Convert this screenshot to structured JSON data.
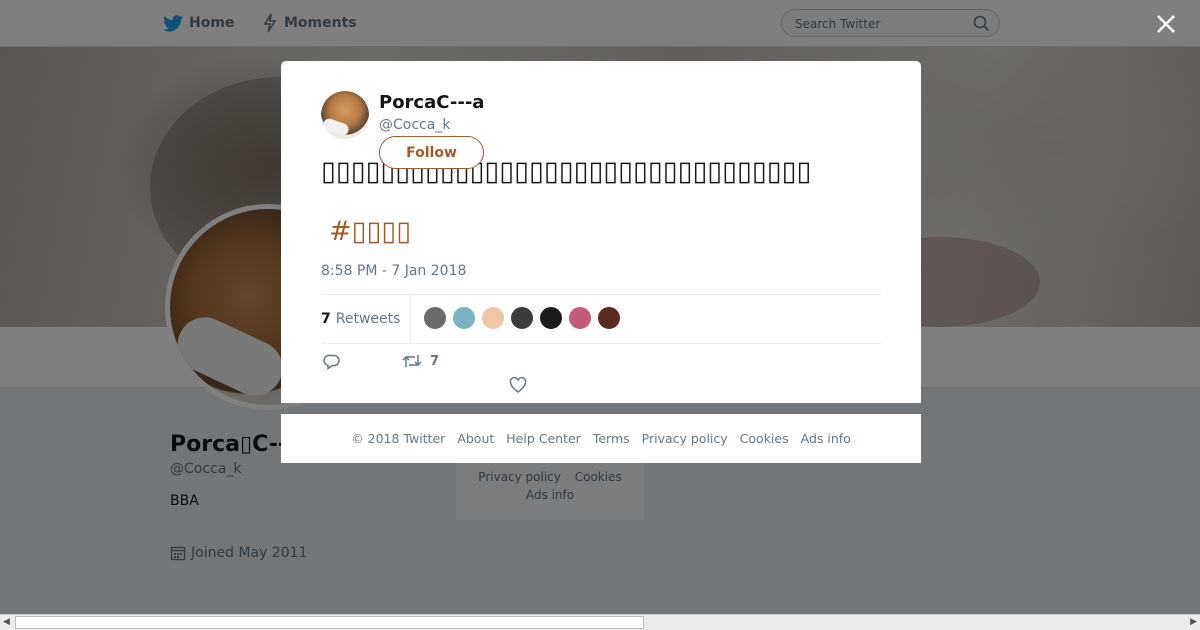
{
  "nav": {
    "home_label": "Home",
    "moments_label": "Moments",
    "search_placeholder": "Search Twitter"
  },
  "profile": {
    "name": "Porca▯C---a",
    "handle": "@Cocca_k",
    "bio": "BBA",
    "joined": "Joined May 2011"
  },
  "bg_footer": {
    "row1": [
      "Privacy policy",
      "Cookies"
    ],
    "row2": [
      "Ads info"
    ]
  },
  "tweet": {
    "author_name": "PorcaC---a",
    "author_handle": "@Cocca_k",
    "follow_label": "Follow",
    "text": "▯▯▯▯▯▯▯▯▯▯▯▯▯▯▯▯▯▯▯▯▯▯▯▯▯▯▯▯▯▯▯▯▯",
    "hashtag": "#▯▯▯▯",
    "timestamp": "8:58 PM - 7 Jan 2018",
    "retweet_count": "7",
    "retweet_label": "Retweets",
    "retweet_action_count": "7",
    "retweeter_colors": [
      "#6b6b6b",
      "#7ab3c4",
      "#f0c6a8",
      "#3b3b3b",
      "#1c1c1c",
      "#c45a7a",
      "#5a2b1f"
    ]
  },
  "footer": {
    "copyright": "© 2018 Twitter",
    "about": "About",
    "help": "Help Center",
    "terms": "Terms",
    "privacy": "Privacy policy",
    "cookies": "Cookies",
    "ads": "Ads info"
  },
  "colors": {
    "accent": "#a05b2c",
    "overlay": "rgba(0,0,0,0.5)"
  },
  "icons": [
    "twitter-bird-icon",
    "moments-bolt-icon",
    "search-icon",
    "close-icon",
    "reply-icon",
    "retweet-icon",
    "like-heart-icon",
    "calendar-icon"
  ]
}
